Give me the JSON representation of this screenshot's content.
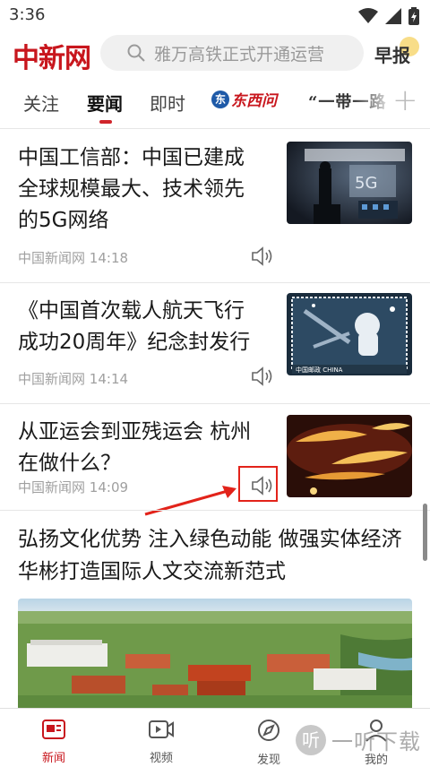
{
  "status_bar": {
    "time": "3:36"
  },
  "header": {
    "logo": "中新网",
    "search_placeholder": "雅万高铁正式开通运营",
    "zaobao": "早报"
  },
  "tabs": [
    {
      "label": "关注"
    },
    {
      "label": "要闻",
      "active": true
    },
    {
      "label": "即时"
    },
    {
      "label": "东西问",
      "badge": "东"
    },
    {
      "label": "“一带一路"
    }
  ],
  "news": [
    {
      "title": "中国工信部：中国已建成全球规模最大、技术领先的5G网络",
      "source": "中国新闻网",
      "time": "14:18",
      "image_text": "5G"
    },
    {
      "title": "《中国首次载人航天飞行成功20周年》纪念封发行",
      "source": "中国新闻网",
      "time": "14:14",
      "image_text": "中国邮政 CHINA"
    },
    {
      "title": "从亚运会到亚残运会 杭州在做什么？",
      "source": "中国新闻网",
      "time": "14:09"
    }
  ],
  "feature": {
    "title": "弘扬文化优势 注入绿色动能 做强实体经济 华彬打造国际人文交流新范式"
  },
  "bottom_nav": [
    {
      "label": "新闻",
      "icon": "news-icon",
      "active": true
    },
    {
      "label": "视频",
      "icon": "video-icon"
    },
    {
      "label": "发现",
      "icon": "discover-icon"
    },
    {
      "label": "我的",
      "icon": "profile-icon"
    }
  ],
  "watermark": {
    "circle": "听",
    "text": "一听下载"
  },
  "colors": {
    "brand_red": "#c8161d",
    "accent_red": "#e2231a"
  }
}
